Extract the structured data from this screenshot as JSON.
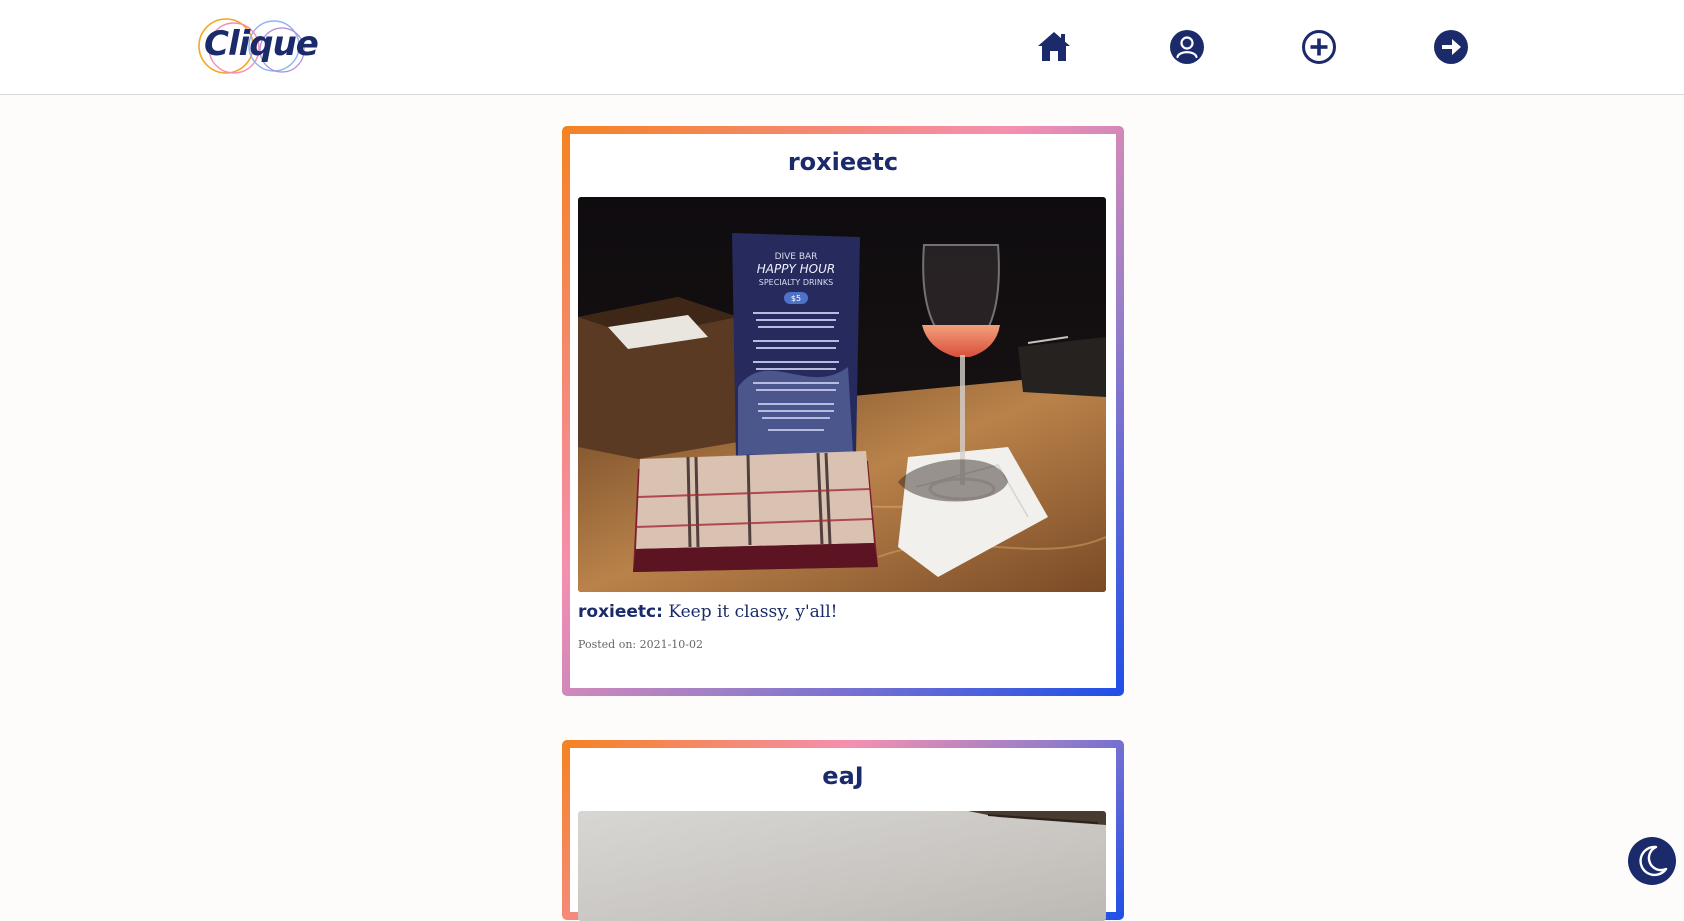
{
  "app": {
    "logo_text": "Clique"
  },
  "nav": {
    "items": [
      {
        "name": "home",
        "icon": "home-icon"
      },
      {
        "name": "profile",
        "icon": "user-circle-icon"
      },
      {
        "name": "add-post",
        "icon": "plus-circle-icon"
      },
      {
        "name": "logout",
        "icon": "arrow-right-circle-icon"
      }
    ]
  },
  "posts": [
    {
      "username": "roxieetc",
      "caption_user": "roxieetc:",
      "caption_text": " Keep it classy, y'all!",
      "posted_on": "Posted on: 2021-10-02",
      "menu_card": {
        "line1": "DIVE BAR",
        "line2": "HAPPY HOUR",
        "line3": "SPECIALTY DRINKS",
        "price": "$5"
      }
    },
    {
      "username": "eaJ"
    }
  ],
  "theme": {
    "navy": "#1b2a6b",
    "border_gradient": [
      "#f58220",
      "#f48fb1",
      "#9c7fc7",
      "#1e4fe8"
    ]
  },
  "dark_mode_icon": "moon-icon"
}
